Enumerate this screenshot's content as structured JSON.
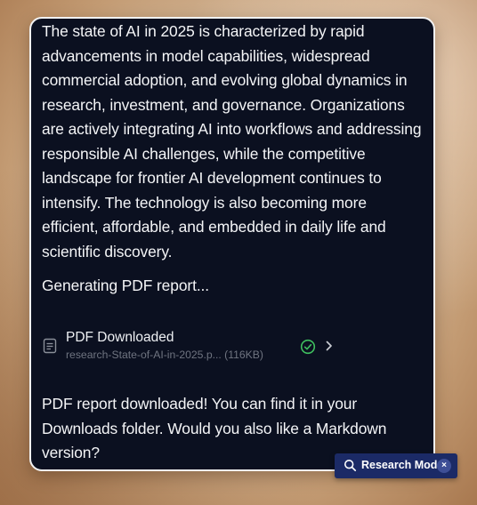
{
  "chat": {
    "summary_text": "The state of AI in 2025 is characterized by rapid advancements in model capabilities, widespread commercial adoption, and evolving global dynamics in research, investment, and governance. Organizations are actively integrating AI into workflows and addressing responsible AI challenges, while the competitive landscape for frontier AI development continues to intensify. The technology is also becoming more efficient, affordable, and embedded in daily life and scientific discovery.",
    "status_text": "Generating PDF report...",
    "file": {
      "title": "PDF Downloaded",
      "meta": "research-State-of-AI-in-2025.p... (116KB)",
      "icon": "document-icon",
      "status_icon": "check-circle-icon",
      "status_color": "#3fbf5f"
    },
    "final_text": "PDF report downloaded! You can find it in your Downloads folder. Would you also like a Markdown version?"
  },
  "mode_pill": {
    "label": "Research Mode",
    "close_glyph": "×",
    "icon": "search-icon",
    "background": "#1b2a66"
  },
  "colors": {
    "card_background": "#0b1020",
    "text": "#f4f5f7",
    "muted_text": "#6f7480"
  }
}
